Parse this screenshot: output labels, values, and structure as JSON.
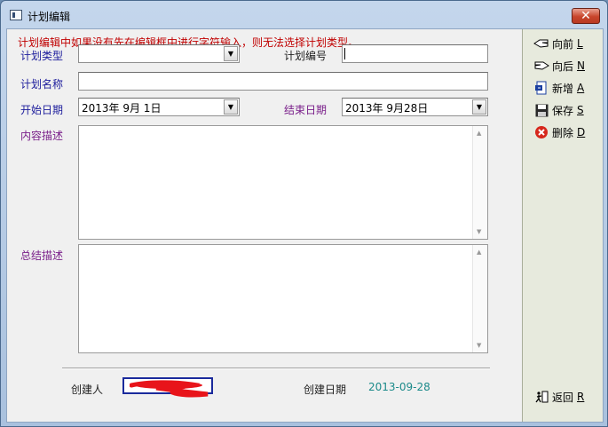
{
  "window": {
    "title": "计划编辑",
    "close_label": "✕"
  },
  "warning": "计划编辑中如果没有先在编辑框中进行字符输入，则无法选择计划类型。",
  "form": {
    "type_label": "计划类型",
    "type_value": "",
    "number_label": "计划编号",
    "number_value": "",
    "name_label": "计划名称",
    "name_value": "",
    "start_label": "开始日期",
    "start_value": "2013年  9月  1日",
    "end_label": "结束日期",
    "end_value": "2013年  9月28日",
    "content_label": "内容描述",
    "content_value": "",
    "summary_label": "总结描述",
    "summary_value": ""
  },
  "footer": {
    "creator_label": "创建人",
    "creator_value": "",
    "created_date_label": "创建日期",
    "created_date_value": "2013-09-28"
  },
  "sidebar": {
    "buttons": [
      {
        "label": "向前",
        "hotkey": "L",
        "icon": "hand-left-icon"
      },
      {
        "label": "向后",
        "hotkey": "N",
        "icon": "hand-right-icon"
      },
      {
        "label": "新增",
        "hotkey": "A",
        "icon": "new-doc-icon"
      },
      {
        "label": "保存",
        "hotkey": "S",
        "icon": "floppy-icon"
      },
      {
        "label": "删除",
        "hotkey": "D",
        "icon": "delete-icon"
      }
    ],
    "return": {
      "label": "返回",
      "hotkey": "R",
      "icon": "exit-icon"
    }
  },
  "colors": {
    "accent_red": "#c00000",
    "label_blue": "#1c1c9c",
    "label_purple": "#7a1f8a",
    "date_teal": "#1b8a8a"
  }
}
